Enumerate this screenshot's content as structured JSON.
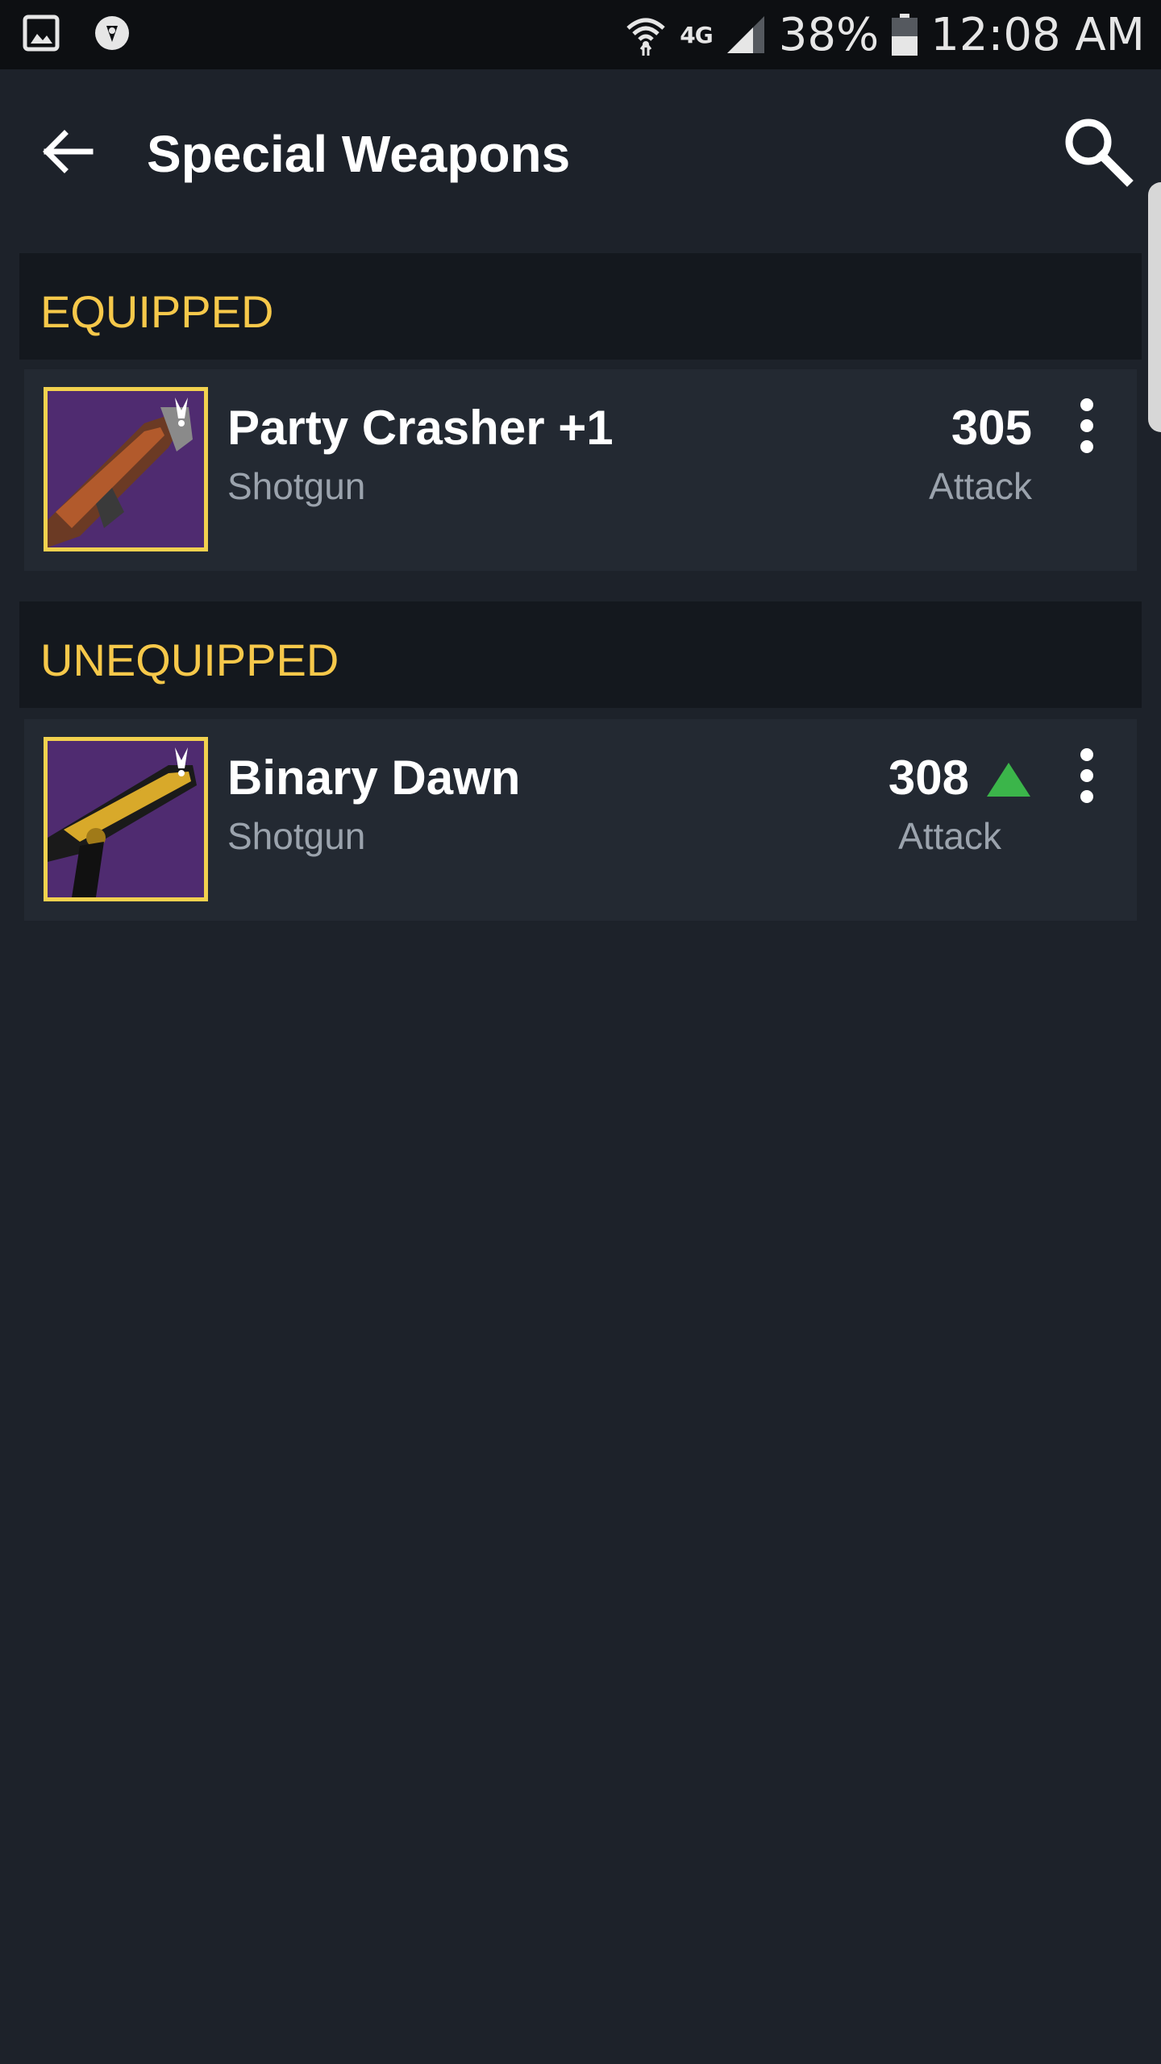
{
  "status_bar": {
    "network": "4G",
    "battery": "38%",
    "time": "12:08 AM",
    "icons": [
      "gallery-icon",
      "destiny-app-icon",
      "wifi-icon",
      "signal-icon",
      "battery-icon"
    ]
  },
  "app_bar": {
    "title": "Special Weapons",
    "back_icon": "arrow-left-icon",
    "search_icon": "search-icon"
  },
  "sections": [
    {
      "header": "EQUIPPED",
      "items": [
        {
          "name": "Party Crasher +1",
          "type": "Shotgun",
          "stat_value": "305",
          "stat_label": "Attack",
          "upgrade": false
        }
      ]
    },
    {
      "header": "UNEQUIPPED",
      "items": [
        {
          "name": "Binary Dawn",
          "type": "Shotgun",
          "stat_value": "308",
          "stat_label": "Attack",
          "upgrade": true
        }
      ]
    }
  ],
  "colors": {
    "background": "#1d222a",
    "section_header_text": "#f6c84a",
    "thumbnail_border": "#f2d14e",
    "upgrade_arrow": "#3bb54a"
  }
}
